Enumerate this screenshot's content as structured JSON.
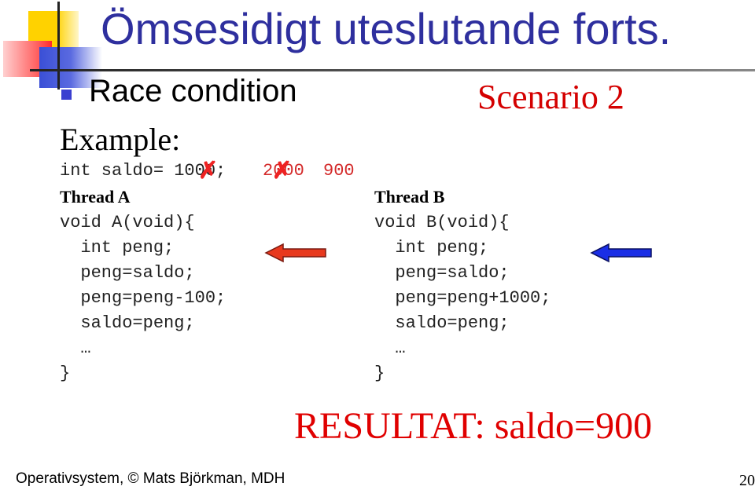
{
  "slide": {
    "title": "Ömsesidigt uteslutande forts.",
    "bullet": "Race condition",
    "scenario": "Scenario 2",
    "example_label": "Example:",
    "declaration": {
      "code": "int saldo= 1000;",
      "annotations": [
        "2000",
        "900"
      ],
      "crossed_out_values": [
        "1000",
        "2000"
      ]
    },
    "thread_a": {
      "label": "Thread A",
      "lines": [
        "void A(void){",
        "  int peng;",
        "  peng=saldo;",
        "  peng=peng-100;",
        "  saldo=peng;",
        "  …",
        "}"
      ],
      "arrow_color": "#e8391e",
      "arrow_points_to_line": 1
    },
    "thread_b": {
      "label": "Thread B",
      "lines": [
        "void B(void){",
        "  int peng;",
        "  peng=saldo;",
        "  peng=peng+1000;",
        "  saldo=peng;",
        "  …",
        "}"
      ],
      "arrow_color": "#1a2ee6",
      "arrow_points_to_line": 1
    },
    "result": "RESULTAT: saldo=900",
    "footer": "Operativsystem, © Mats Björkman, MDH",
    "page_number": "20"
  },
  "colors": {
    "title": "#2e2f9e",
    "accent_red": "#e00000",
    "bullet": "#3a3fd0"
  }
}
